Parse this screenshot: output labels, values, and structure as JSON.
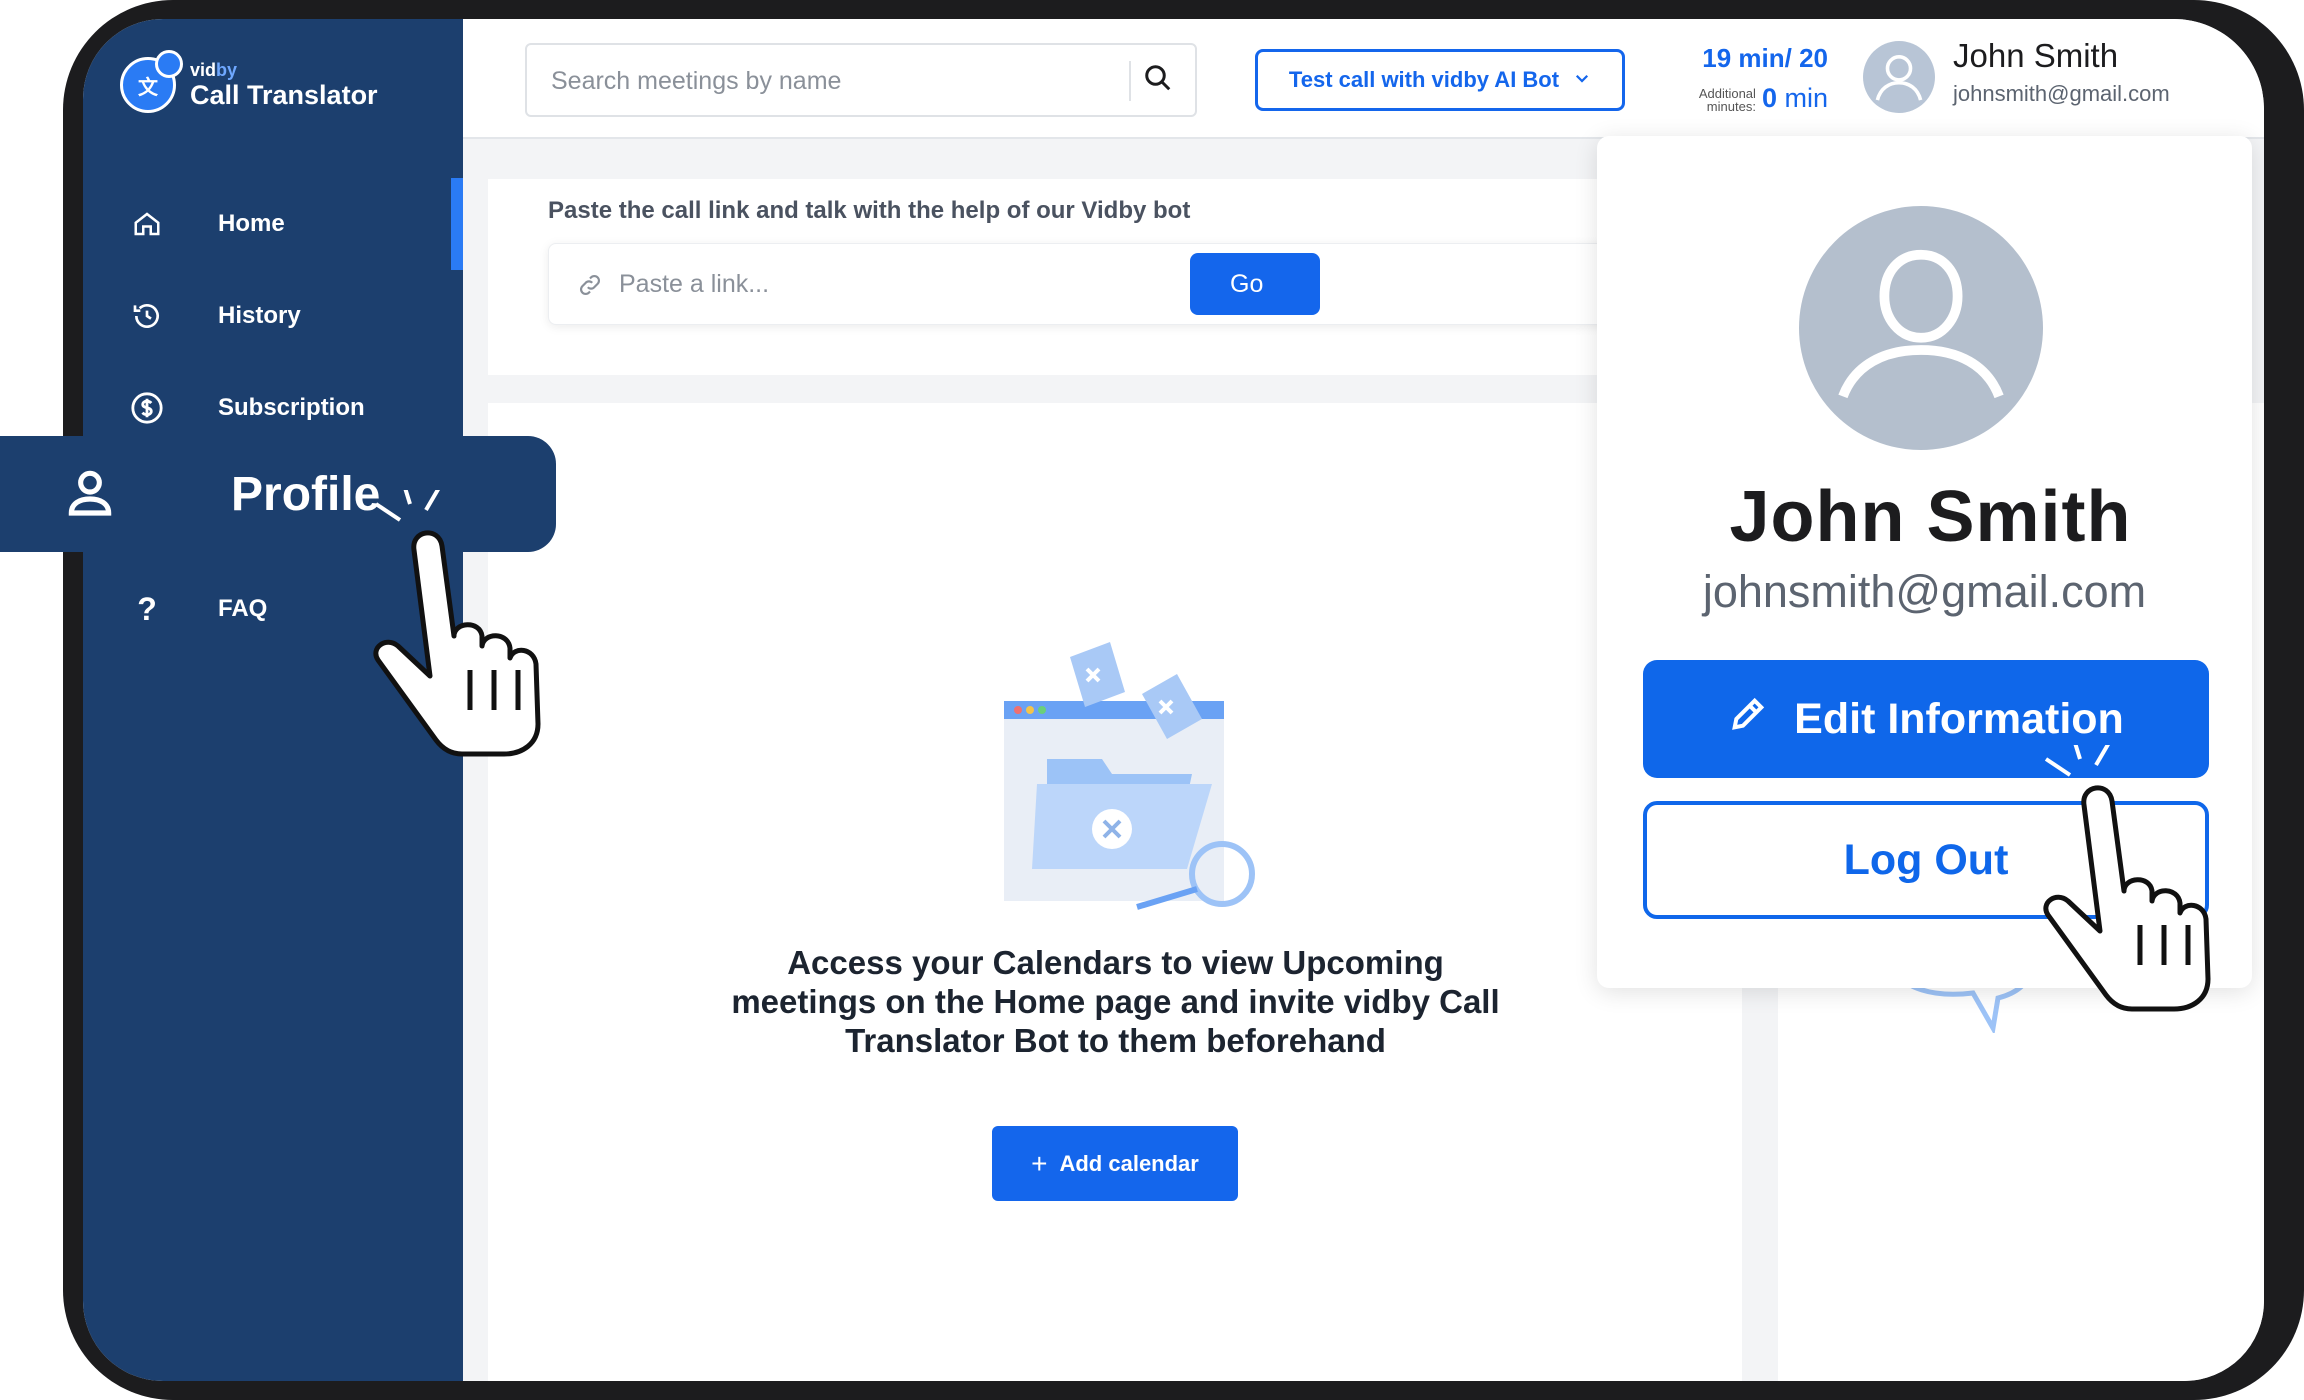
{
  "app": {
    "brand_small": "vid",
    "brand_small_accent": "by",
    "brand_name": "Call Translator"
  },
  "sidebar": {
    "items": [
      {
        "label": "Home",
        "icon": "home-icon"
      },
      {
        "label": "History",
        "icon": "history-icon"
      },
      {
        "label": "Subscription",
        "icon": "dollar-icon"
      },
      {
        "label": "Profile",
        "icon": "user-icon"
      },
      {
        "label": "FAQ",
        "icon": "question-icon"
      }
    ],
    "active": "Home"
  },
  "topbar": {
    "search_placeholder": "Search meetings by name",
    "test_call_label": "Test call with vidby AI Bot",
    "minutes_used": "19 min",
    "minutes_total": "/ 20",
    "additional_label": "Additional minutes:",
    "additional_value": "0",
    "additional_unit": "min",
    "user_name": "John Smith",
    "user_email": "johnsmith@gmail.com"
  },
  "paste": {
    "title": "Paste the call link and talk with the help of our Vidby bot",
    "placeholder": "Paste a link...",
    "go_label": "Go"
  },
  "main": {
    "calendar_message": "Access your Calendars to view Upcoming meetings on the Home page and invite vidby Call Translator Bot to them beforehand",
    "add_calendar_label": "Add calendar"
  },
  "dropdown": {
    "name": "John Smith",
    "email": "johnsmith@gmail.com",
    "edit_label": "Edit Information",
    "logout_label": "Log Out"
  },
  "colors": {
    "sidebar": "#1c3f6e",
    "accent": "#1466ec",
    "avatar": "#b4bfcd"
  }
}
